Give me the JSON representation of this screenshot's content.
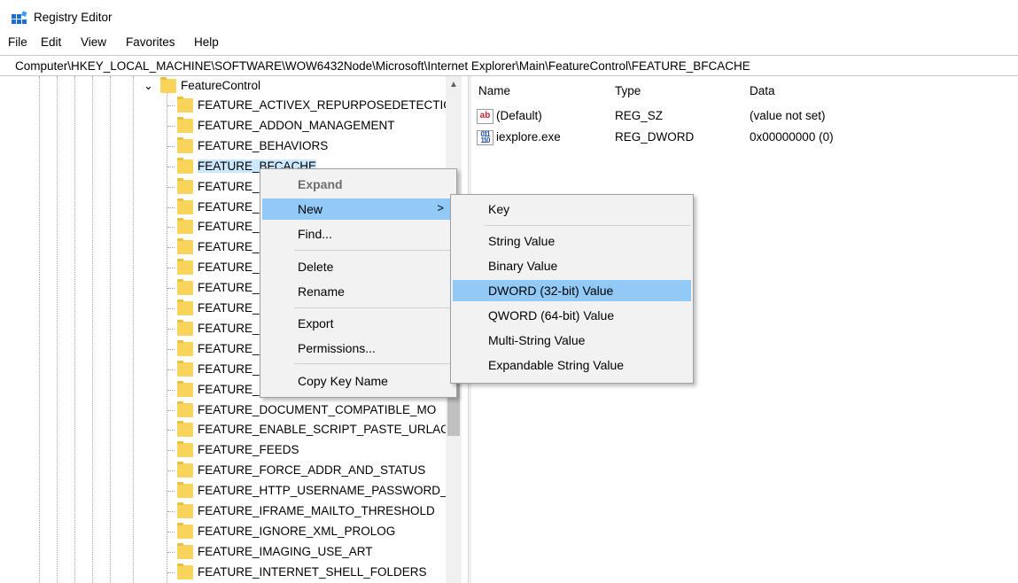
{
  "window": {
    "title": "Registry Editor"
  },
  "menubar": [
    "File",
    "Edit",
    "View",
    "Favorites",
    "Help"
  ],
  "address": "Computer\\HKEY_LOCAL_MACHINE\\SOFTWARE\\WOW6432Node\\Microsoft\\Internet Explorer\\Main\\FeatureControl\\FEATURE_BFCACHE",
  "tree": {
    "parent": "FeatureControl",
    "expander_glyph": "⌄",
    "items": [
      "FEATURE_ACTIVEX_REPURPOSEDETECTIC",
      "FEATURE_ADDON_MANAGEMENT",
      "FEATURE_BEHAVIORS",
      "FEATURE_BFCACHE",
      "FEATURE_",
      "FEATURE_",
      "FEATURE_",
      "FEATURE_",
      "FEATURE_",
      "FEATURE_",
      "FEATURE_",
      "FEATURE_",
      "FEATURE_",
      "FEATURE_",
      "FEATURE_",
      "FEATURE_DOCUMENT_COMPATIBLE_MO",
      "FEATURE_ENABLE_SCRIPT_PASTE_URLAC",
      "FEATURE_FEEDS",
      "FEATURE_FORCE_ADDR_AND_STATUS",
      "FEATURE_HTTP_USERNAME_PASSWORD_",
      "FEATURE_IFRAME_MAILTO_THRESHOLD",
      "FEATURE_IGNORE_XML_PROLOG",
      "FEATURE_IMAGING_USE_ART",
      "FEATURE_INTERNET_SHELL_FOLDERS"
    ],
    "selected_index": 3
  },
  "values": {
    "columns": [
      "Name",
      "Type",
      "Data"
    ],
    "rows": [
      {
        "icon": "string-value-icon",
        "icon_text": "ab",
        "name": "(Default)",
        "type": "REG_SZ",
        "data": "(value not set)"
      },
      {
        "icon": "dword-value-icon",
        "icon_text": "011\n110",
        "name": "iexplore.exe",
        "type": "REG_DWORD",
        "data": "0x00000000 (0)"
      }
    ]
  },
  "context_menu": {
    "items": [
      "Expand",
      "New",
      "Find...",
      "Delete",
      "Rename",
      "Export",
      "Permissions...",
      "Copy Key Name"
    ],
    "submenu_arrow": ">",
    "highlighted": "New"
  },
  "submenu": {
    "items": [
      "Key",
      "String Value",
      "Binary Value",
      "DWORD (32-bit) Value",
      "QWORD (64-bit) Value",
      "Multi-String Value",
      "Expandable String Value"
    ],
    "highlighted": "DWORD (32-bit) Value"
  },
  "scrollbar": {
    "up_glyph": "▲"
  },
  "colors": {
    "selection": "#cce8ff",
    "menu_highlight": "#91c9f7",
    "folder": "#f8d55a"
  }
}
